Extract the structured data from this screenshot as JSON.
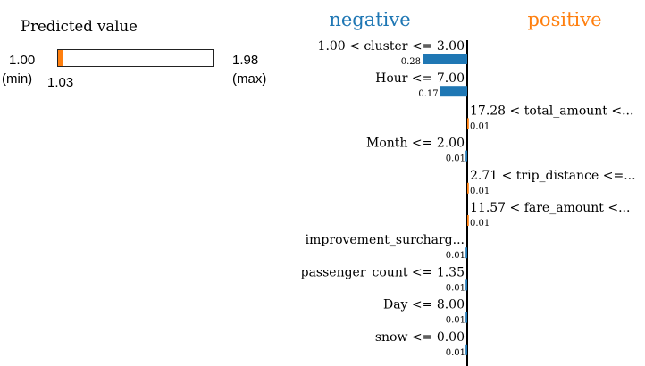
{
  "prediction": {
    "title": "Predicted value",
    "min_value": "1.00",
    "min_label": "(min)",
    "value": "1.03",
    "value_number": 1.03,
    "max_value": "1.98",
    "max_label": "(max)",
    "min_number": 1.0,
    "max_number": 1.98,
    "bar_color": "#ff7f0e"
  },
  "colors": {
    "negative": "#1f77b4",
    "positive": "#ff7f0e",
    "axis": "#000000"
  },
  "chart_data": {
    "type": "bar",
    "orientation": "horizontal",
    "headings": {
      "negative": "negative",
      "positive": "positive"
    },
    "features": [
      {
        "label": "1.00 < cluster <= 3.00",
        "weight": -0.28,
        "weight_label": "0.28"
      },
      {
        "label": "Hour <= 7.00",
        "weight": -0.17,
        "weight_label": "0.17"
      },
      {
        "label": "17.28 < total_amount <...",
        "weight": 0.01,
        "weight_label": "0.01"
      },
      {
        "label": "Month <= 2.00",
        "weight": -0.01,
        "weight_label": "0.01"
      },
      {
        "label": "2.71 < trip_distance <=...",
        "weight": 0.01,
        "weight_label": "0.01"
      },
      {
        "label": "11.57 < fare_amount <...",
        "weight": 0.01,
        "weight_label": "0.01"
      },
      {
        "label": "improvement_surcharg...",
        "weight": -0.01,
        "weight_label": "0.01"
      },
      {
        "label": "passenger_count <= 1.35",
        "weight": -0.01,
        "weight_label": "0.01"
      },
      {
        "label": "Day <= 8.00",
        "weight": -0.01,
        "weight_label": "0.01"
      },
      {
        "label": "snow <= 0.00",
        "weight": -0.01,
        "weight_label": "0.01"
      }
    ],
    "xlim": [
      -0.28,
      0.28
    ]
  }
}
